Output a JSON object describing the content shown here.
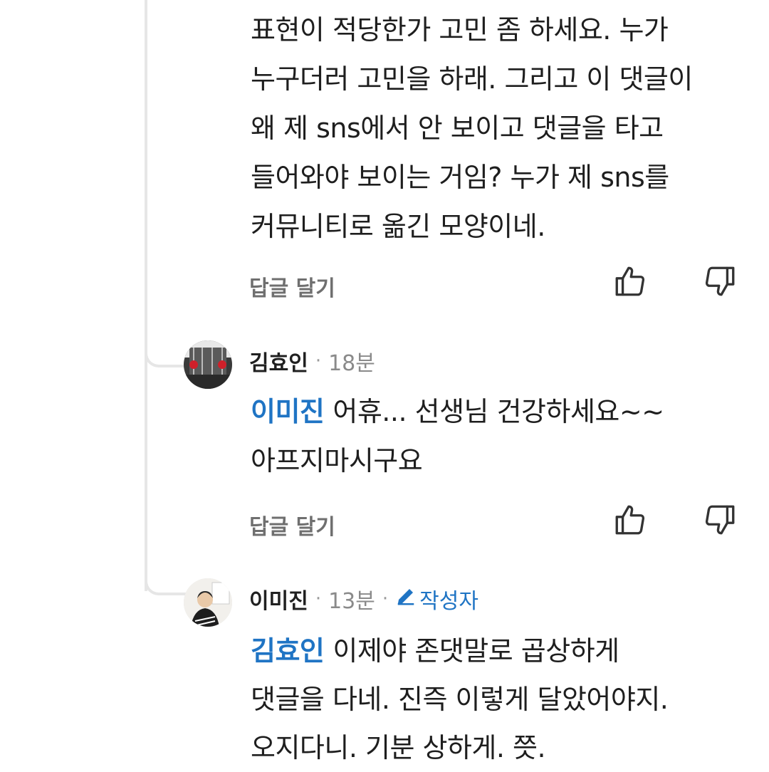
{
  "comments": [
    {
      "body_lines": [
        "표현이 적당한가 고민 좀 하세요. 누가",
        "누구더러 고민을 하래. 그리고 이 댓글이",
        "왜 제 sns에서 안 보이고 댓글을 타고",
        "들어와야 보이는 거임? 누가 제 sns를",
        "커뮤니티로 옮긴 모양이네."
      ],
      "reply_label": "답글 달기"
    },
    {
      "author": "김효인",
      "time": "18분",
      "mention": "이미진",
      "body": "어휴...  선생님  건강하세요~~\n아프지마시구요",
      "reply_label": "답글 달기"
    },
    {
      "author": "이미진",
      "time": "13분",
      "writer_badge": "작성자",
      "mention": "김효인",
      "body": "이제야 존댓말로 곱상하게\n댓글을 다네. 진즉 이렇게 달았어야지.\n오지다니. 기분 상하게. 쯧."
    }
  ],
  "icons": {
    "like": "thumbs-up-icon",
    "dislike": "thumbs-down-icon",
    "pencil": "pencil-icon"
  },
  "colors": {
    "mention": "#1f74c4",
    "thread_line": "#e6e6e6",
    "muted": "#8a8a8a"
  }
}
